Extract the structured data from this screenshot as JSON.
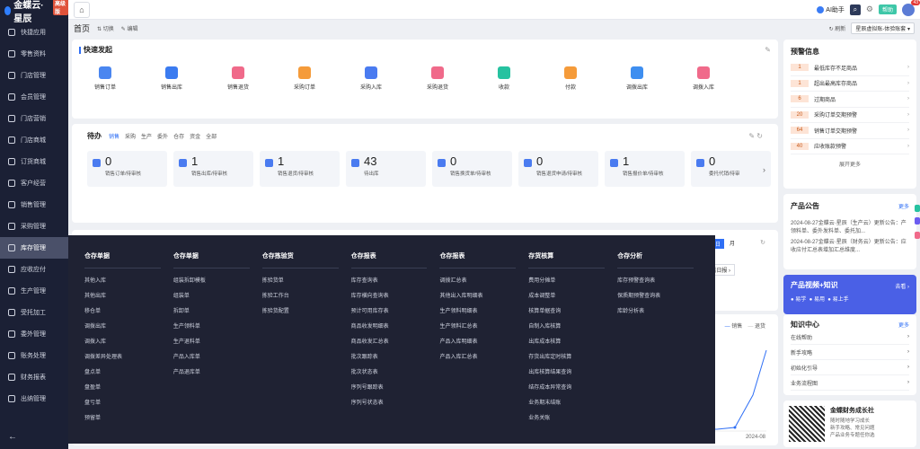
{
  "app": {
    "logo_text": "金蝶云·星辰",
    "badge": "高级版"
  },
  "sidebar": {
    "items": [
      {
        "label": "快捷应用",
        "active": false
      },
      {
        "label": "零售资料",
        "active": false
      },
      {
        "label": "门店管理",
        "active": false
      },
      {
        "label": "会员管理",
        "active": false
      },
      {
        "label": "门店营销",
        "active": false
      },
      {
        "label": "门店商城",
        "active": false
      },
      {
        "label": "订货商城",
        "active": false
      },
      {
        "label": "客户经营",
        "active": false
      },
      {
        "label": "销售管理",
        "active": false
      },
      {
        "label": "采购管理",
        "active": false
      },
      {
        "label": "库存管理",
        "active": true
      },
      {
        "label": "应收应付",
        "active": false
      },
      {
        "label": "生产管理",
        "active": false
      },
      {
        "label": "受托加工",
        "active": false
      },
      {
        "label": "委外管理",
        "active": false
      },
      {
        "label": "账务处理",
        "active": false
      },
      {
        "label": "财务报表",
        "active": false
      },
      {
        "label": "出纳管理",
        "active": false
      }
    ],
    "collapse_icon": "←"
  },
  "topbar": {
    "ai_label": "AI助手",
    "help_label": "帮助",
    "notif_count": "43"
  },
  "crumb": {
    "title": "首页",
    "switch_label": "切换",
    "edit_label": "编辑",
    "refresh_label": "刷新",
    "account": "星辰虚拟账-体验账套"
  },
  "quick": {
    "title": "快速发起",
    "items": [
      {
        "label": "销售订单",
        "color": "#4a86f0"
      },
      {
        "label": "销售出库",
        "color": "#3b7bf0"
      },
      {
        "label": "销售退货",
        "color": "#f06a8a"
      },
      {
        "label": "采购订单",
        "color": "#f59b3a"
      },
      {
        "label": "采购入库",
        "color": "#4a7bf0"
      },
      {
        "label": "采购退货",
        "color": "#f06a8a"
      },
      {
        "label": "收款",
        "color": "#26c2a0"
      },
      {
        "label": "付款",
        "color": "#f59b3a"
      },
      {
        "label": "调拨出库",
        "color": "#3e8ef0"
      },
      {
        "label": "调拨入库",
        "color": "#f06a8a"
      }
    ]
  },
  "todo": {
    "title": "待办",
    "tabs": [
      "销售",
      "采购",
      "生产",
      "委外",
      "仓存",
      "资金",
      "全部"
    ],
    "cards": [
      {
        "num": "0",
        "label": "销售订单/待审核"
      },
      {
        "num": "1",
        "label": "销售出库/待审核"
      },
      {
        "num": "1",
        "label": "销售退货/待审核"
      },
      {
        "num": "43",
        "label": "待出库"
      },
      {
        "num": "0",
        "label": "销售换货单/待审核"
      },
      {
        "num": "0",
        "label": "销售退货申请/待审核"
      },
      {
        "num": "1",
        "label": "销售报价单/待审核"
      },
      {
        "num": "0",
        "label": "委托代销/待审"
      }
    ]
  },
  "menu": {
    "columns": [
      {
        "header": "仓存单据",
        "items": [
          "其他入库",
          "其他出库",
          "移仓单",
          "调拨出库",
          "调拨入库",
          "调拨差异处理表",
          "盘点单",
          "盘盈单",
          "盘亏单",
          "预留单"
        ]
      },
      {
        "header": "仓存单据",
        "items": [
          "组装拆卸模板",
          "组装单",
          "拆卸单",
          "生产领料单",
          "生产退料单",
          "产品入库单",
          "产品退库单"
        ]
      },
      {
        "header": "仓存拣验货",
        "items": [
          "拣验货单",
          "拣验工作台",
          "拣验货配置"
        ]
      },
      {
        "header": "仓存报表",
        "items": [
          "库存查询表",
          "库存横向查询表",
          "预计可用库存表",
          "商品收发明细表",
          "商品收发汇总表",
          "批次跟踪表",
          "批次状态表",
          "序列号跟踪表",
          "序列号状态表"
        ]
      },
      {
        "header": "仓存报表",
        "items": [
          "调拨汇总表",
          "其他出入库明细表",
          "生产领料明细表",
          "生产领料汇总表",
          "产品入库明细表",
          "产品入库汇总表"
        ]
      },
      {
        "header": "存货核算",
        "items": [
          "费用分摊单",
          "成本调整单",
          "核算单据查询",
          "自制入库核算",
          "出库成本核算",
          "存货出库定时核算",
          "出库核算结果查询",
          "结存成本异常查询",
          "业务期末结账",
          "业务关账"
        ]
      },
      {
        "header": "仓存分析",
        "items": [
          "库存预警查询表",
          "保质期预警查询表",
          "库龄分析表"
        ]
      }
    ]
  },
  "alerts": {
    "title": "预警信息",
    "items": [
      {
        "count": "1",
        "label": "最低库存不足商品"
      },
      {
        "count": "1",
        "label": "超出最高库存商品"
      },
      {
        "count": "6",
        "label": "过期商品"
      },
      {
        "count": "20",
        "label": "采购订单交期预警"
      },
      {
        "count": "64",
        "label": "销售订单交期预警"
      },
      {
        "count": "40",
        "label": "应收账款预警"
      }
    ],
    "more": "展开更多"
  },
  "notice": {
    "title": "产品公告",
    "more": "更多",
    "text1": "2024-08-27金蝶云·星辰（生产云）更新公告：产领料单、委外发料单、委托加...",
    "text2": "2024-08-27金蝶云·星辰（财务云）更新公告：应收应付汇总表增加汇总维度..."
  },
  "video": {
    "title": "产品视频+知识",
    "enter": "去看",
    "sub1": "易学",
    "sub2": "易用",
    "sub3": "易上手"
  },
  "knowledge": {
    "title": "知识中心",
    "more": "更多",
    "items": [
      "在线帮助",
      "新手攻略",
      "初始化引导",
      "业务流程图"
    ]
  },
  "community": {
    "title": "金蝶财务成长社",
    "line1": "随时随地学习成长",
    "line2": "新手攻略、常见问题",
    "line3": "产品业务专题任你选"
  },
  "chart_top": {
    "tabs": [
      "日",
      "月"
    ],
    "btn": "查看日报"
  },
  "chart_bot": {
    "legend1": "销售",
    "legend2": "退货",
    "x_last": "2024-08",
    "x_prev": "..."
  }
}
